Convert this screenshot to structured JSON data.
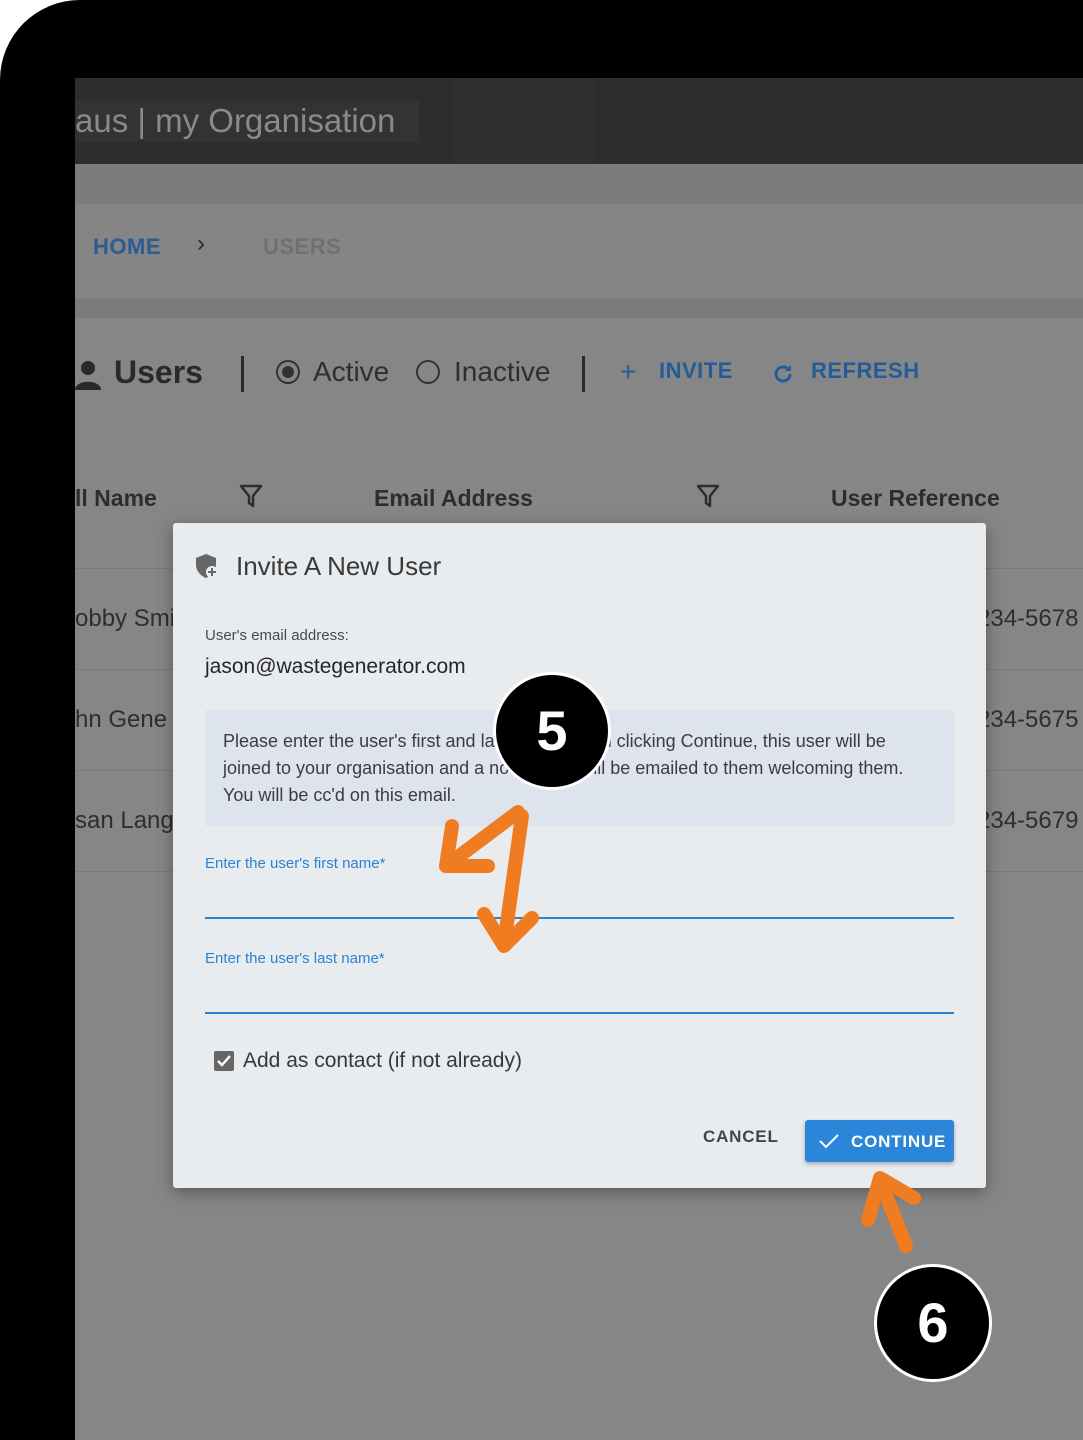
{
  "app": {
    "title": "aus | my Organisation"
  },
  "breadcrumb": {
    "home": "HOME",
    "separator": "›",
    "current": "USERS"
  },
  "toolbar": {
    "title": "Users",
    "filter_active": "Active",
    "filter_inactive": "Inactive",
    "invite_label": "INVITE",
    "refresh_label": "REFRESH"
  },
  "table": {
    "headers": [
      "ll Name",
      "Email Address",
      "User Reference"
    ],
    "rows": [
      {
        "name": "obby Smit",
        "ref": "234-5678"
      },
      {
        "name": "hn Gene",
        "ref": "234-5675"
      },
      {
        "name": "san Lang",
        "ref": "234-5679"
      }
    ]
  },
  "dialog": {
    "title": "Invite A New User",
    "email_label": "User's email address:",
    "email_value": "jason@wastegenerator.com",
    "info_text": "Please enter the user's first and last name. Upon clicking Continue, this user will be joined to your organisation and a notification will be emailed to them welcoming them. You will be cc'd on this email.",
    "first_name_label": "Enter the user's first name*",
    "first_name_value": "",
    "last_name_label": "Enter the user's last name*",
    "last_name_value": "",
    "add_contact_label": "Add as contact (if not already)",
    "add_contact_checked": true,
    "cancel_label": "CANCEL",
    "continue_label": "CONTINUE"
  },
  "annotations": {
    "step_a": "5",
    "step_b": "6",
    "arrow_color": "#f07c22"
  },
  "colors": {
    "accent": "#2b85d8",
    "link": "#245c99",
    "overlay": "#868686"
  }
}
